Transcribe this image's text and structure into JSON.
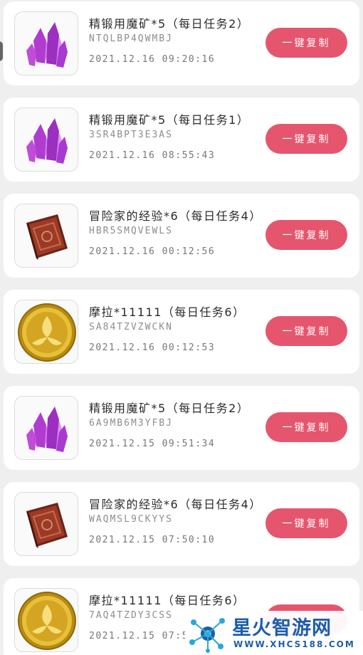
{
  "button_label": "一键复制",
  "items": [
    {
      "icon": "purple-crystal-icon",
      "title": "精锻用魔矿*5（每日任务2）",
      "code": "NTQLBP4QWMBJ",
      "time": "2021.12.16 09:20:16"
    },
    {
      "icon": "purple-crystal-icon",
      "title": "精锻用魔矿*5（每日任务1）",
      "code": "3SR4BPT3E3AS",
      "time": "2021.12.16 08:55:43"
    },
    {
      "icon": "adventure-book-icon",
      "title": "冒险家的经验*6（每日任务4）",
      "code": "HBR5SMQVEWLS",
      "time": "2021.12.16 00:12:56"
    },
    {
      "icon": "mora-coin-icon",
      "title": "摩拉*11111（每日任务6）",
      "code": "SA84TZVZWCKN",
      "time": "2021.12.16 00:12:53"
    },
    {
      "icon": "purple-crystal-icon",
      "title": "精锻用魔矿*5（每日任务2）",
      "code": "6A9MB6M3YFBJ",
      "time": "2021.12.15 09:51:34"
    },
    {
      "icon": "adventure-book-icon",
      "title": "冒险家的经验*6（每日任务4）",
      "code": "WAQMSL9CKYYS",
      "time": "2021.12.15 07:50:10"
    },
    {
      "icon": "mora-coin-icon",
      "title": "摩拉*11111（每日任务6）",
      "code": "7AQ4TZDY3CSS",
      "time": "2021.12.15 07:50:0"
    }
  ],
  "watermark": {
    "name": "星火智游网",
    "url": "WWW.XHCS188.COM",
    "color": "#1d5ea8"
  },
  "colors": {
    "button": "#e6556e",
    "card": "#ffffff",
    "background": "#efefef"
  }
}
